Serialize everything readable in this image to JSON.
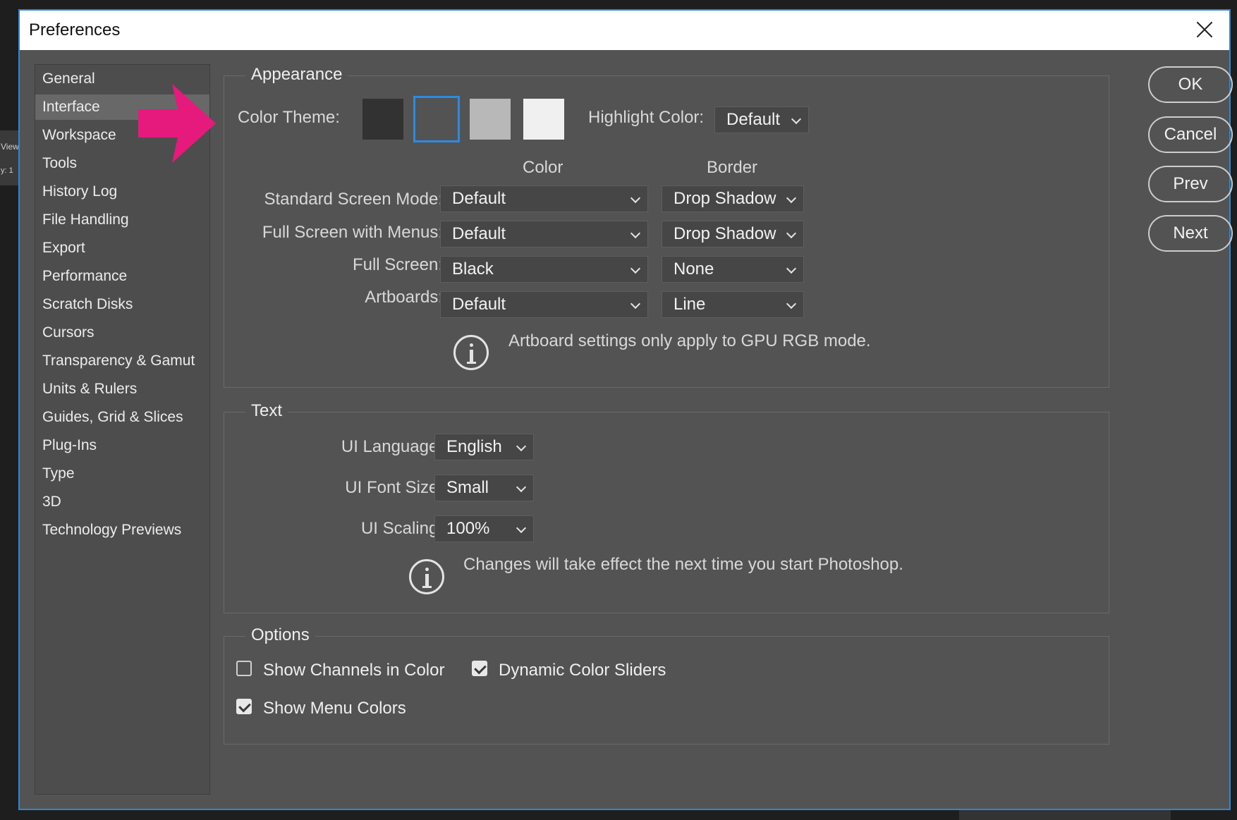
{
  "background": {
    "side_label_1": "View",
    "side_label_2": "y:  1"
  },
  "dialog": {
    "title": "Preferences",
    "accent_color": "#2f86d6",
    "close_icon": "close-icon"
  },
  "sidebar": {
    "items": [
      {
        "label": "General"
      },
      {
        "label": "Interface",
        "selected": true
      },
      {
        "label": "Workspace"
      },
      {
        "label": "Tools"
      },
      {
        "label": "History Log"
      },
      {
        "label": "File Handling"
      },
      {
        "label": "Export"
      },
      {
        "label": "Performance"
      },
      {
        "label": "Scratch Disks"
      },
      {
        "label": "Cursors"
      },
      {
        "label": "Transparency & Gamut"
      },
      {
        "label": "Units & Rulers"
      },
      {
        "label": "Guides, Grid & Slices"
      },
      {
        "label": "Plug-Ins"
      },
      {
        "label": "Type"
      },
      {
        "label": "3D"
      },
      {
        "label": "Technology Previews"
      }
    ]
  },
  "annotation": {
    "arrow_color": "#e6197d",
    "icon": "pink-arrow-icon"
  },
  "appearance": {
    "legend": "Appearance",
    "color_theme_label": "Color Theme:",
    "themes": [
      {
        "color": "#323232",
        "selected": false
      },
      {
        "color": "#535353",
        "selected": true
      },
      {
        "color": "#b8b8b8",
        "selected": false
      },
      {
        "color": "#f0f0f0",
        "selected": false
      }
    ],
    "highlight_label": "Highlight Color:",
    "highlight_value": "Default",
    "col_color": "Color",
    "col_border": "Border",
    "rows": [
      {
        "label": "Standard Screen Mode:",
        "color": "Default",
        "border": "Drop Shadow"
      },
      {
        "label": "Full Screen with Menus:",
        "color": "Default",
        "border": "Drop Shadow"
      },
      {
        "label": "Full Screen:",
        "color": "Black",
        "border": "None"
      },
      {
        "label": "Artboards:",
        "color": "Default",
        "border": "Line"
      }
    ],
    "note": "Artboard settings only apply to GPU RGB mode."
  },
  "text": {
    "legend": "Text",
    "language_label": "UI Language:",
    "language_value": "English",
    "font_size_label": "UI Font Size:",
    "font_size_value": "Small",
    "scaling_label": "UI Scaling:",
    "scaling_value": "100%",
    "note": "Changes will take effect the next time you start Photoshop."
  },
  "options": {
    "legend": "Options",
    "show_channels": {
      "label": "Show Channels in Color",
      "checked": false
    },
    "dynamic_sliders": {
      "label": "Dynamic Color Sliders",
      "checked": true
    },
    "show_menu_colors": {
      "label": "Show Menu Colors",
      "checked": true
    }
  },
  "buttons": {
    "ok": "OK",
    "cancel": "Cancel",
    "prev": "Prev",
    "next": "Next"
  }
}
